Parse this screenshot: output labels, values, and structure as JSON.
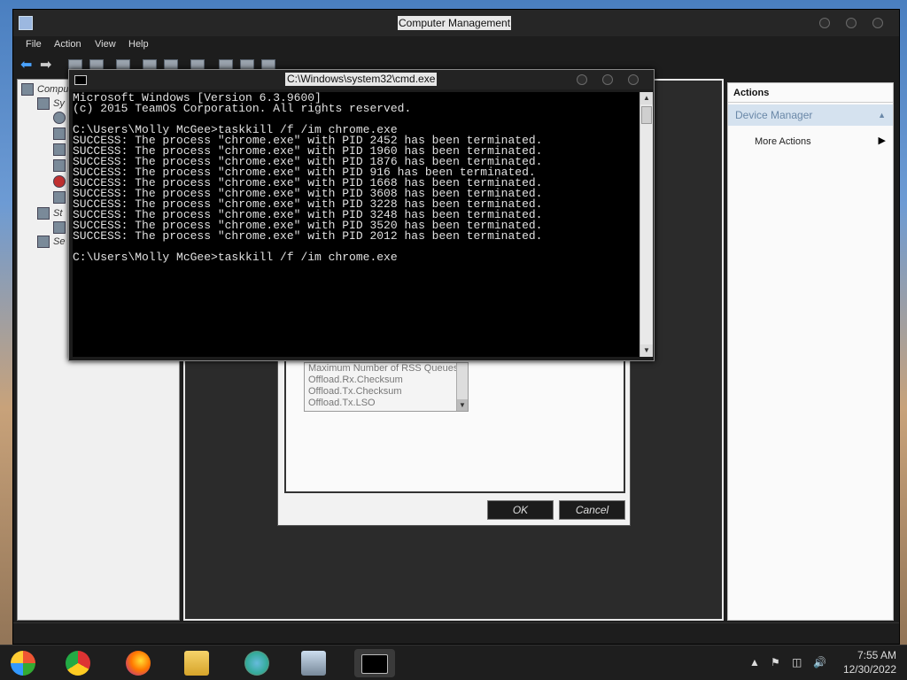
{
  "cm_window": {
    "title": "Computer Management",
    "menu": [
      "File",
      "Action",
      "View",
      "Help"
    ],
    "tree": [
      "Compu",
      "Sy",
      "St",
      "Se"
    ],
    "actions": {
      "header": "Actions",
      "section": "Device Manager",
      "more_actions": "More Actions"
    }
  },
  "dialog": {
    "list": [
      "Maximum Number of RSS Queues",
      "Offload.Rx.Checksum",
      "Offload.Tx.Checksum",
      "Offload.Tx.LSO"
    ],
    "ok_label": "OK",
    "cancel_label": "Cancel"
  },
  "cmd_window": {
    "title": "C:\\Windows\\system32\\cmd.exe",
    "lines": [
      "Microsoft Windows [Version 6.3.9600]",
      "(c) 2015 TeamOS Corporation. All rights reserved.",
      "",
      "C:\\Users\\Molly McGee>taskkill /f /im chrome.exe",
      "SUCCESS: The process \"chrome.exe\" with PID 2452 has been terminated.",
      "SUCCESS: The process \"chrome.exe\" with PID 1960 has been terminated.",
      "SUCCESS: The process \"chrome.exe\" with PID 1876 has been terminated.",
      "SUCCESS: The process \"chrome.exe\" with PID 916 has been terminated.",
      "SUCCESS: The process \"chrome.exe\" with PID 1668 has been terminated.",
      "SUCCESS: The process \"chrome.exe\" with PID 3608 has been terminated.",
      "SUCCESS: The process \"chrome.exe\" with PID 3228 has been terminated.",
      "SUCCESS: The process \"chrome.exe\" with PID 3248 has been terminated.",
      "SUCCESS: The process \"chrome.exe\" with PID 3520 has been terminated.",
      "SUCCESS: The process \"chrome.exe\" with PID 2012 has been terminated.",
      "",
      "C:\\Users\\Molly McGee>taskkill /f /im chrome.exe"
    ]
  },
  "taskbar": {
    "apps": [
      "windows-start-icon",
      "chrome-icon",
      "firefox-icon",
      "file-explorer-icon",
      "network-users-icon",
      "computer-management-icon",
      "cmd-icon"
    ],
    "tray_icons": [
      "show-hidden-icons",
      "flag-icon",
      "network-icon",
      "volume-icon"
    ],
    "time": "7:55 AM",
    "date": "12/30/2022"
  },
  "colors": {
    "accent": "#4aa3ff",
    "console_bg": "#000000",
    "console_text": "#e0e0e0"
  }
}
